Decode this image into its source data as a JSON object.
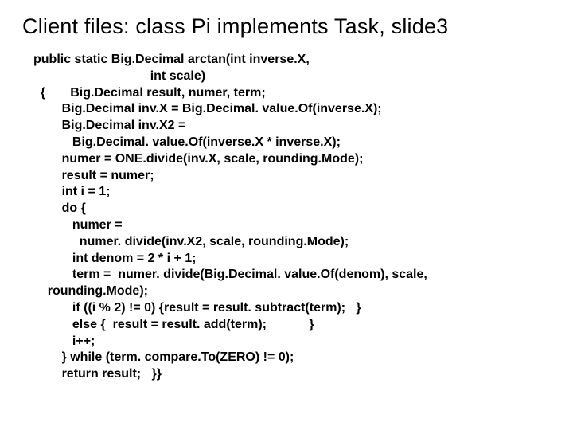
{
  "title": "Client files: class Pi implements Task, slide3",
  "code": "public static Big.Decimal arctan(int inverse.X,\n                                 int scale)\n  {       Big.Decimal result, numer, term;\n        Big.Decimal inv.X = Big.Decimal. value.Of(inverse.X);\n        Big.Decimal inv.X2 =\n           Big.Decimal. value.Of(inverse.X * inverse.X);\n        numer = ONE.divide(inv.X, scale, rounding.Mode);\n        result = numer;\n        int i = 1;\n        do {\n           numer =\n             numer. divide(inv.X2, scale, rounding.Mode);\n           int denom = 2 * i + 1;\n           term =  numer. divide(Big.Decimal. value.Of(denom), scale,\n    rounding.Mode);\n           if ((i % 2) != 0) {result = result. subtract(term);   }\n           else {  result = result. add(term);            }\n           i++;\n        } while (term. compare.To(ZERO) != 0);\n        return result;   }}"
}
